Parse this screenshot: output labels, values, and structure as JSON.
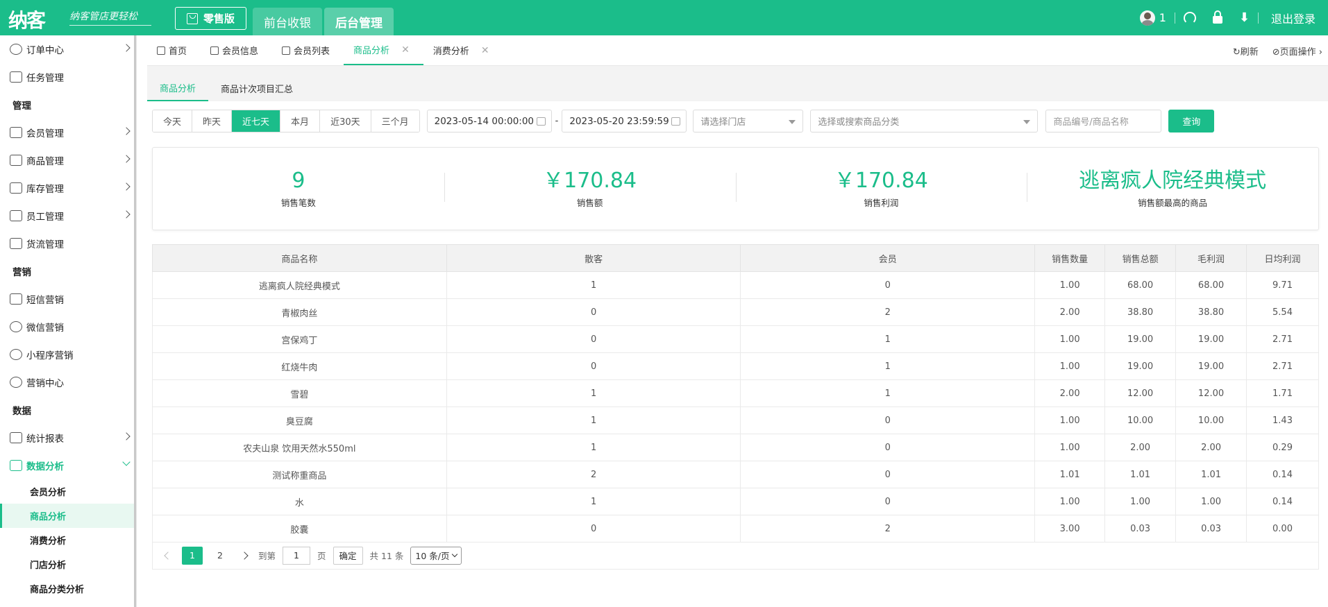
{
  "topbar": {
    "logo": "纳客",
    "slogan": "纳客管店更轻松",
    "edition": "零售版",
    "nav": [
      "前台收银",
      "后台管理"
    ],
    "user_count": "1",
    "logout": "退出登录",
    "color": "#1bbd8a"
  },
  "sidebar": {
    "items": [
      {
        "type": "item",
        "label": "订单中心",
        "icon": "globe-icon",
        "chevron": true
      },
      {
        "type": "item",
        "label": "任务管理",
        "icon": "task-icon",
        "chevron": false
      },
      {
        "type": "group",
        "label": "管理"
      },
      {
        "type": "item",
        "label": "会员管理",
        "icon": "crown-icon",
        "chevron": true
      },
      {
        "type": "item",
        "label": "商品管理",
        "icon": "grid-icon",
        "chevron": true
      },
      {
        "type": "item",
        "label": "库存管理",
        "icon": "box-icon",
        "chevron": true
      },
      {
        "type": "item",
        "label": "员工管理",
        "icon": "user-icon",
        "chevron": true
      },
      {
        "type": "item",
        "label": "货流管理",
        "icon": "truck-icon",
        "chevron": false
      },
      {
        "type": "group",
        "label": "营销"
      },
      {
        "type": "item",
        "label": "短信营销",
        "icon": "mail-icon",
        "chevron": false
      },
      {
        "type": "item",
        "label": "微信营销",
        "icon": "wechat-icon",
        "chevron": false
      },
      {
        "type": "item",
        "label": "小程序营销",
        "icon": "miniprogram-icon",
        "chevron": false
      },
      {
        "type": "item",
        "label": "营销中心",
        "icon": "target-icon",
        "chevron": false
      },
      {
        "type": "group",
        "label": "数据"
      },
      {
        "type": "item",
        "label": "统计报表",
        "icon": "bar-chart-icon",
        "chevron": true
      },
      {
        "type": "item",
        "label": "数据分析",
        "icon": "monitor-chart-icon",
        "chevron": true,
        "expanded": true
      }
    ],
    "subitems": [
      "会员分析",
      "商品分析",
      "消费分析",
      "门店分析",
      "商品分类分析"
    ],
    "active_sub": 1
  },
  "tabs": [
    {
      "label": "首页",
      "icon": "home-icon",
      "closable": false
    },
    {
      "label": "会员信息",
      "icon": "user-icon",
      "closable": false
    },
    {
      "label": "会员列表",
      "icon": "list-icon",
      "closable": false
    },
    {
      "label": "商品分析",
      "icon": "",
      "closable": true,
      "active": true
    },
    {
      "label": "消费分析",
      "icon": "",
      "closable": true
    }
  ],
  "tab_actions": {
    "refresh": "刷新",
    "page_ops": "页面操作"
  },
  "subtabs": [
    "商品分析",
    "商品计次项目汇总"
  ],
  "filters": {
    "quick": [
      "今天",
      "昨天",
      "近七天",
      "本月",
      "近30天",
      "三个月"
    ],
    "quick_active": 2,
    "start": "2023-05-14 00:00:00",
    "end": "2023-05-20 23:59:59",
    "dash": "-",
    "store_placeholder": "请选择门店",
    "category_placeholder": "选择或搜索商品分类",
    "search_placeholder": "商品编号/商品名称",
    "query": "查询"
  },
  "stats": [
    {
      "value": "9",
      "label": "销售笔数"
    },
    {
      "value": "￥170.84",
      "label": "销售额"
    },
    {
      "value": "￥170.84",
      "label": "销售利润"
    },
    {
      "value": "逃离疯人院经典模式",
      "label": "销售额最高的商品"
    }
  ],
  "table": {
    "columns": [
      "商品名称",
      "散客",
      "会员",
      "销售数量",
      "销售总额",
      "毛利润",
      "日均利润"
    ],
    "rows": [
      [
        "逃离疯人院经典模式",
        "1",
        "0",
        "1.00",
        "68.00",
        "68.00",
        "9.71"
      ],
      [
        "青椒肉丝",
        "0",
        "2",
        "2.00",
        "38.80",
        "38.80",
        "5.54"
      ],
      [
        "宫保鸡丁",
        "0",
        "1",
        "1.00",
        "19.00",
        "19.00",
        "2.71"
      ],
      [
        "红烧牛肉",
        "0",
        "1",
        "1.00",
        "19.00",
        "19.00",
        "2.71"
      ],
      [
        "雪碧",
        "1",
        "1",
        "2.00",
        "12.00",
        "12.00",
        "1.71"
      ],
      [
        "臭豆腐",
        "1",
        "0",
        "1.00",
        "10.00",
        "10.00",
        "1.43"
      ],
      [
        "农夫山泉 饮用天然水550ml",
        "1",
        "0",
        "1.00",
        "2.00",
        "2.00",
        "0.29"
      ],
      [
        "测试称重商品",
        "2",
        "0",
        "1.01",
        "1.01",
        "1.01",
        "0.14"
      ],
      [
        "水",
        "1",
        "0",
        "1.00",
        "1.00",
        "1.00",
        "0.14"
      ],
      [
        "胶囊",
        "0",
        "2",
        "3.00",
        "0.03",
        "0.03",
        "0.00"
      ]
    ]
  },
  "pager": {
    "pages": [
      "1",
      "2"
    ],
    "current": "1",
    "goto": "到第",
    "page_unit": "页",
    "confirm": "确定",
    "total": "共 11 条",
    "page_size": "10 条/页"
  }
}
